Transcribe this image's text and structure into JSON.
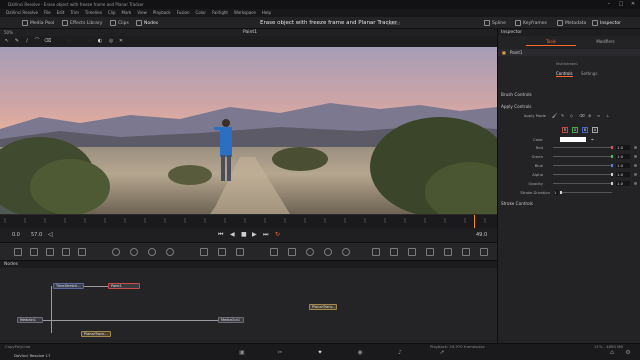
{
  "window": {
    "title": "DaVinci Resolve - Erase object with freeze frame and Planar Tracker"
  },
  "menu": [
    "DaVinci Resolve",
    "File",
    "Edit",
    "Trim",
    "Timeline",
    "Clip",
    "Mark",
    "View",
    "Playback",
    "Fusion",
    "Color",
    "Fairlight",
    "Workspace",
    "Help"
  ],
  "toolbar": {
    "media_pool": "Media Pool",
    "effects_library": "Effects Library",
    "clips": "Clips",
    "nodes": "Nodes",
    "project_title": "Erase object with freeze frame and Planar Tracker",
    "edited": "Edited",
    "spline": "Spline",
    "keyframes": "Keyframes",
    "metadata": "Metadata",
    "inspector": "Inspector"
  },
  "viewer": {
    "name": "Paint1",
    "zoom": "50%",
    "timecode_start": "0.0",
    "timecode_current": "57.0",
    "timecode_end": "49.0"
  },
  "nodes_panel": {
    "title": "Nodes",
    "nodes": [
      "TimeStretch...",
      "Paint1",
      "MediaIn1",
      "MediaOut1",
      "PlanarTrack...",
      "PlanarTrans..."
    ]
  },
  "inspector": {
    "title": "Inspector",
    "tabs": [
      "Tools",
      "Modifiers"
    ],
    "node_name": "Paint1",
    "sub_label": "Multistroke1",
    "sub_tabs": [
      "Controls",
      "Settings"
    ],
    "sections": {
      "brush": "Brush Controls",
      "apply": "Apply Controls",
      "stroke": "Stroke Controls"
    },
    "apply_mode_label": "Apply Mode",
    "channels": [
      "R",
      "G",
      "B",
      "A"
    ],
    "color_label": "Color",
    "params": [
      {
        "label": "Red",
        "value": "1.0"
      },
      {
        "label": "Green",
        "value": "1.0"
      },
      {
        "label": "Blue",
        "value": "1.0"
      },
      {
        "label": "Alpha",
        "value": "1.0"
      },
      {
        "label": "Opacity",
        "value": "1.0"
      }
    ],
    "stroke_duration_label": "Stroke Duration",
    "stroke_duration_value": "1"
  },
  "status": {
    "left": "CopyPolyLine",
    "app": "DaVinci Resolve 17",
    "playback": "Playback: 29.970 frames/sec",
    "memory": "11% - 4690 MB"
  },
  "colors": {
    "accent": "#ff6a2a",
    "selection": "#c84a4a"
  }
}
